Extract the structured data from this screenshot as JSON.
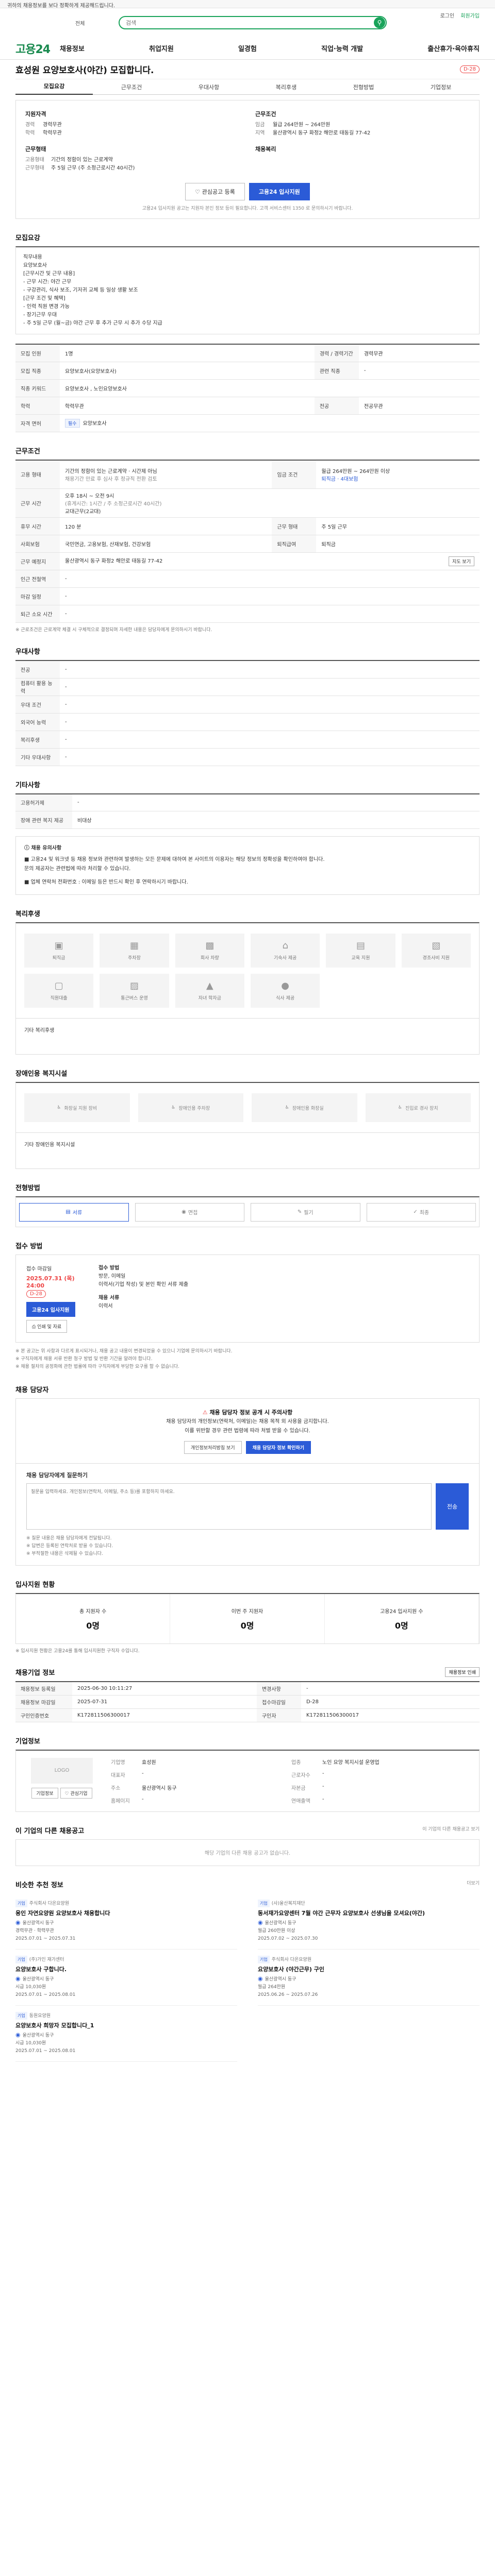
{
  "topbar": {
    "notice": "귀하의 채용정보를 보다 정확하게 제공해드립니다."
  },
  "search": {
    "category": "전체",
    "placeholder": "검색",
    "links": [
      "로그인",
      "회원가입"
    ],
    "accent": "#19a35a"
  },
  "nav": {
    "logo": "고용24",
    "items": [
      "채용정보",
      "취업지원",
      "일경험",
      "직업·능력 개발",
      "출산휴가·육아휴직"
    ]
  },
  "job": {
    "title": "효성원 요양보호사(야간) 모집합니다.",
    "dday": "D-28"
  },
  "tabs": [
    "모집요강",
    "근무조건",
    "우대사항",
    "복리후생",
    "전형방법",
    "기업정보"
  ],
  "summary": {
    "left_title": "지원자격",
    "left_rows": [
      {
        "k": "경력",
        "v": "경력무관"
      },
      {
        "k": "학력",
        "v": "학력무관"
      }
    ],
    "left_title2": "근무형태",
    "left_rows2": [
      {
        "k": "고용형태",
        "v": "기간의 정함이 있는 근로계약"
      },
      {
        "k": "근무형태",
        "v": "주 5일 근무 (주 소정근로시간 40시간)"
      }
    ],
    "right_title": "근무조건",
    "right_rows": [
      {
        "k": "임금",
        "v": "월급 264만원 ~ 264만원"
      },
      {
        "k": "지역",
        "v": "울산광역시 동구 화정2 해안로 태동길 77-42"
      }
    ],
    "right_title2": "채용복리",
    "btn_save": "관심공고 등록",
    "btn_apply": "고용24 입사지원",
    "note": "고용24 입사지원 공고는 지원자 본인 정보 등이 필요합니다. 고객 서비스센터 1350 로 문의하시기 바랍니다."
  },
  "recruit": {
    "title": "모집요강",
    "body": [
      "직무내용",
      "요양보호사",
      "",
      "[근무시간 및 근무 내용]",
      "- 근무 시간: 야간 근무",
      "- 구강관리, 식사 보조, 기저귀 교체 등 일상 생활 보조",
      "",
      "[근무 조건 및 혜택]",
      "- 인력 직원 변경 가능",
      "- 장기근무 우대",
      "- 주 5일 근무 (월~금) 야간 근무 후 추가 근무 시 추가 수당 지급"
    ]
  },
  "recruit_table": [
    {
      "k1": "모집 인원",
      "v1": "1명",
      "k2": "경력 / 경력기간",
      "v2": "경력무관"
    },
    {
      "k1": "모집 직종",
      "v1": "요양보호사(요양보호사)",
      "k2": "관련 직종",
      "v2": "-"
    },
    {
      "k1": "직종 키워드",
      "v1": "요양보호사 , 노인요양보호사",
      "k2": "",
      "v2": ""
    },
    {
      "k1": "학력",
      "v1": "학력무관",
      "k2": "전공",
      "v2": "전공무관"
    },
    {
      "k1": "자격 면허",
      "v1": "요양보호사",
      "k2": "",
      "v2": ""
    }
  ],
  "work": {
    "title": "근무조건",
    "employ_type": "기간의 정함이 있는 근로계약 · 시간제 아님",
    "employ_sub": "채용기간 만료 후 심사 후 정규직 전환 검토",
    "wage": "월급 264만원 ~ 264만원 이상",
    "benefits_label": "퇴직금 · 4대보험",
    "hours": "오후 18시 ~ 오전 9시",
    "hours_sub": "(휴게시간: 1시간 / 주 소정근로시간 40시간)",
    "shift": "교대근무(2교대)",
    "days": "주 5일 근무",
    "holiday": "주휴 · 매주 토요일 · 일요일 · 근로자의 날",
    "addr": "울산광역시 동구 화정2 해안로 태동길 77-42",
    "map_btn": "지도 보기",
    "rows": [
      {
        "k": "고용 형태",
        "v": "기간의 정함이 있는 근로계약 · 시간제 아님",
        "k2": "임금 조건",
        "v2": "월급 264만원 ~ 264만원 이상"
      },
      {
        "k": "근무 시간",
        "v": "오후 18시~오전 9시",
        "k2": "",
        "v2": ""
      },
      {
        "k": "휴무 시간",
        "v": "120 분",
        "k2": "근무 형태",
        "v2": "주 5일 근무"
      },
      {
        "k": "사회보험",
        "v": "국민연금, 고용보험, 산재보험, 건강보험",
        "k2": "퇴직급여",
        "v2": "퇴직금"
      },
      {
        "k": "근무 예정지",
        "v": "울산광역시 동구 화정2 해안로 태동길 77-42",
        "k2": "",
        "v2": ""
      },
      {
        "k": "인근 전철역",
        "v": "-",
        "k2": "",
        "v2": ""
      },
      {
        "k": "마감 일정",
        "v": "-",
        "k2": "",
        "v2": ""
      },
      {
        "k": "퇴근 소요 시간",
        "v": "-",
        "k2": "",
        "v2": ""
      }
    ],
    "note": "※ 근로조건은 근로계약 체결 시 구체적으로 결정되며 자세한 내용은 담당자에게 문의하시기 바랍니다."
  },
  "prefer": {
    "title": "우대사항",
    "rows": [
      {
        "k": "전공",
        "v": "-"
      },
      {
        "k": "컴퓨터 활용 능력",
        "v": "-"
      },
      {
        "k": "우대 조건",
        "v": "-"
      },
      {
        "k": "외국어 능력",
        "v": "-"
      },
      {
        "k": "복리후생",
        "v": "-"
      },
      {
        "k": "기타 우대사항",
        "v": "-"
      }
    ]
  },
  "other": {
    "title": "기타사항",
    "rows": [
      {
        "k": "고용허가제",
        "v": "-"
      },
      {
        "k": "장애 관련 복지 제공",
        "v": "비대상"
      }
    ],
    "notice_title": "채용 유의사항",
    "notice": [
      "■ 고용24 및 워크넷 등 채용 정보와 관련하여 발생하는 모든 문제에 대하여 본 사이트의 이용자는 해당 정보의 정확성을 확인하여야 합니다.",
      "문의 제공자는 관련법에 따라 처리할 수 있습니다.",
      "■ 업체 연락처 전화번호 : 이메일 등은 반드시 확인 후 연락하시기 바랍니다."
    ]
  },
  "welfare": {
    "title": "복리후생",
    "items": [
      "퇴직금",
      "주차장",
      "회사 차량",
      "기숙사 제공",
      "교육 지원",
      "경조사비 지원",
      "직원대출",
      "통근버스 운영",
      "자녀 학자금",
      "식사 제공"
    ],
    "extra_label": "기타 복리후생"
  },
  "disability": {
    "title": "장애인용 복지시설",
    "items": [
      "화장실 지원 장비",
      "장애인용 주차장",
      "장애인용 화장실",
      "진입로 경사 장치"
    ],
    "extra_label": "기타 장애인용 복지시설"
  },
  "process": {
    "title": "전형방법",
    "steps": [
      "서류",
      "면접",
      "필기",
      "최종"
    ]
  },
  "apply": {
    "title": "접수 방법",
    "period_label": "접수 마감일",
    "period": "2025.07.31 (목) 24:00",
    "dday": "D-28",
    "btn_apply": "고용24 입사지원",
    "btn_print": "인쇄 및 자료",
    "method_label": "접수 방법",
    "method": "방문, 이메일",
    "docs": "이력서(기업 작성) 및 본인 확인 서류 제출",
    "detail_label": "채용 서류",
    "detail": "이력서",
    "notes": [
      "※ 본 공고는 위 사항과 다르게 표시되거나, 채용 공고 내용이 변경되었을 수 있으니 기업에 문의하시기 바랍니다.",
      "※ 구직자에게 채용 서류 반환 청구 방법 및 반환 기간을 알려야 합니다.",
      "※ 채용 절차의 공정화에 관한 법률에 따라 구직자에게 부당한 요구를 할 수 없습니다."
    ]
  },
  "contact": {
    "title": "채용 담당자",
    "warn": "채용 담당자 정보 공개 시 주의사항",
    "line1": "채용 담당자의 개인정보(연락처, 이메일)는 채용 목적 외 사용을 금지합니다.",
    "line2": "이를 위반할 경우 관련 법령에 따라 처벌 받을 수 있습니다.",
    "btn1": "개인정보처리방침 보기",
    "btn2": "채용 담당자 정보 확인하기"
  },
  "inquiry": {
    "title": "채용 담당자에게 질문하기",
    "placeholder": "질문을 입력하세요. 개인정보(연락처, 이메일, 주소 등)를 포함하지 마세요.",
    "btn": "전송",
    "notes": [
      "※ 질문 내용은 채용 담당자에게 전달됩니다.",
      "※ 답변은 등록된 연락처로 받을 수 있습니다.",
      "※ 부적절한 내용은 삭제될 수 있습니다."
    ]
  },
  "stats": {
    "title": "입사지원 현황",
    "items": [
      {
        "label": "총 지원자 수",
        "num": "0명"
      },
      {
        "label": "이번 주 지원자",
        "num": "0명"
      },
      {
        "label": "고용24 입사지원 수",
        "num": "0명"
      }
    ],
    "note": "※ 입사지원 현황은 고용24를 통해 입사지원한 구직자 수입니다."
  },
  "jobinfo": {
    "title": "채용기업 정보",
    "print_btn": "채용정보 인쇄",
    "rows": [
      {
        "k": "채용정보 등록일",
        "v": "2025-06-30 10:11:27",
        "k2": "변경사항",
        "v2": "-"
      },
      {
        "k": "채용정보 마감일",
        "v": "2025-07-31",
        "k2": "접수마감일",
        "v2": "D-28"
      },
      {
        "k": "구인인증번호",
        "v": "K172811506300017",
        "k2": "구인자",
        "v2": "K172811506300017"
      }
    ]
  },
  "company": {
    "title": "기업정보",
    "logo_text": "LOGO",
    "btn1": "기업정보",
    "btn2": "관심기업",
    "fields": [
      {
        "k": "기업명",
        "v": "효성원"
      },
      {
        "k": "업종",
        "v": "노인 요양 복지시설 운영업"
      },
      {
        "k": "대표자",
        "v": "-"
      },
      {
        "k": "근로자수",
        "v": "-"
      },
      {
        "k": "주소",
        "v": "울산광역시 동구"
      },
      {
        "k": "자본금",
        "v": "-"
      },
      {
        "k": "홈페이지",
        "v": "-"
      },
      {
        "k": "연매출액",
        "v": "-"
      }
    ]
  },
  "same_company": {
    "title": "이 기업의 다른 채용공고",
    "link": "이 기업의 다른 채용공고 보기",
    "empty": "해당 기업의 다른 채용 공고가 없습니다."
  },
  "recommend": {
    "title": "비슷한 추천 정보",
    "more": "더보기",
    "items": [
      {
        "co": "주식회사 다온요양원",
        "title": "용인 자연요양원 요양보호사 채용합니다",
        "meta1": "울산광역시 동구",
        "meta2": "경력무관 · 학력무관",
        "date": "2025.07.01 ~ 2025.07.31"
      },
      {
        "co": "(사)울산복지재단",
        "title": "동서재가요양센터 7월 야간 근무자 요양보호사 선생님을 모셔요(야간)",
        "meta1": "울산광역시 동구",
        "meta2": "월급 260만원 이상",
        "date": "2025.07.02 ~ 2025.07.30"
      },
      {
        "co": "(주)가인 재가센터",
        "title": "요양보호사 구합니다.",
        "meta1": "울산광역시 동구",
        "meta2": "시급 10,030원",
        "date": "2025.07.01 ~ 2025.08.01"
      },
      {
        "co": "주식회사 다온요양원",
        "title": "요양보호사 (야간근무) 구인",
        "meta1": "울산광역시 동구",
        "meta2": "월급 264만원",
        "date": "2025.06.26 ~ 2025.07.26"
      },
      {
        "co": "동원요양원",
        "title": "요양보호사 희망자 모집합니다_1",
        "meta1": "울산광역시 동구",
        "meta2": "시급 10,030원",
        "date": "2025.07.01 ~ 2025.08.01"
      }
    ]
  }
}
